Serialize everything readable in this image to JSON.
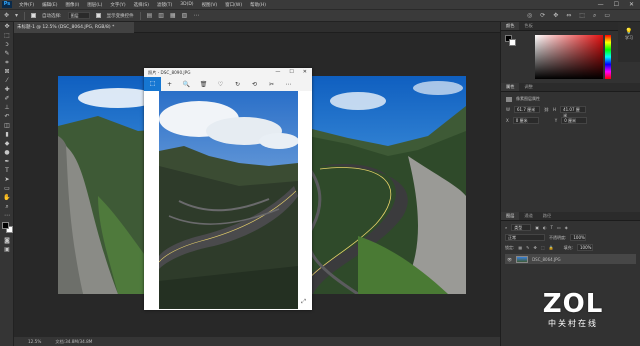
{
  "app": {
    "logo": "Ps"
  },
  "menu": [
    "文件(F)",
    "编辑(E)",
    "图像(I)",
    "图层(L)",
    "文字(Y)",
    "选择(S)",
    "滤镜(T)",
    "3D(D)",
    "视图(V)",
    "窗口(W)",
    "帮助(H)"
  ],
  "window_controls": [
    "—",
    "☐",
    "✕"
  ],
  "options": {
    "auto_select_label": "自动选择:",
    "layer_value": "图层",
    "transform_label": "显示变换控件"
  },
  "document_tab": {
    "title": "未标题-1 @ 12.5% (DSC_8064.JPG, RGB/8) *"
  },
  "status": {
    "zoom": "12.5%",
    "doc_info": "文档:34.8M/34.8M"
  },
  "viewer": {
    "title": "照片 - DSC_8090.JPG",
    "toolbar": [
      "⬚",
      "+",
      "🔍",
      "🗑",
      "♡",
      "↻",
      "⟲",
      "✂",
      "⋯"
    ],
    "expand_icon": "⤢"
  },
  "color_panel": {
    "tabs": [
      "颜色",
      "色板"
    ]
  },
  "properties_panel": {
    "tabs": [
      "属性",
      "调整"
    ],
    "layer_type": "像素图层属性",
    "w_label": "W",
    "w_value": "61.7 厘米",
    "h_label": "H",
    "h_value": "41.07 厘米",
    "x_label": "X",
    "x_value": "0 厘米",
    "y_label": "Y",
    "y_value": "0 厘米"
  },
  "layers_panel": {
    "tabs": [
      "图层",
      "通道",
      "路径"
    ],
    "kind": "类型",
    "blend_mode": "正常",
    "opacity_label": "不透明度:",
    "opacity_value": "100%",
    "lock_label": "锁定:",
    "fill_label": "填充:",
    "fill_value": "100%",
    "layer_name": "DSC_8064.JPG"
  },
  "dock": {
    "label": "学习"
  },
  "watermark": {
    "brand": "ZOL",
    "tagline": "中关村在线"
  },
  "colors": {
    "foreground": "#000000",
    "background": "#ffffff",
    "accent": "#1677d2"
  }
}
